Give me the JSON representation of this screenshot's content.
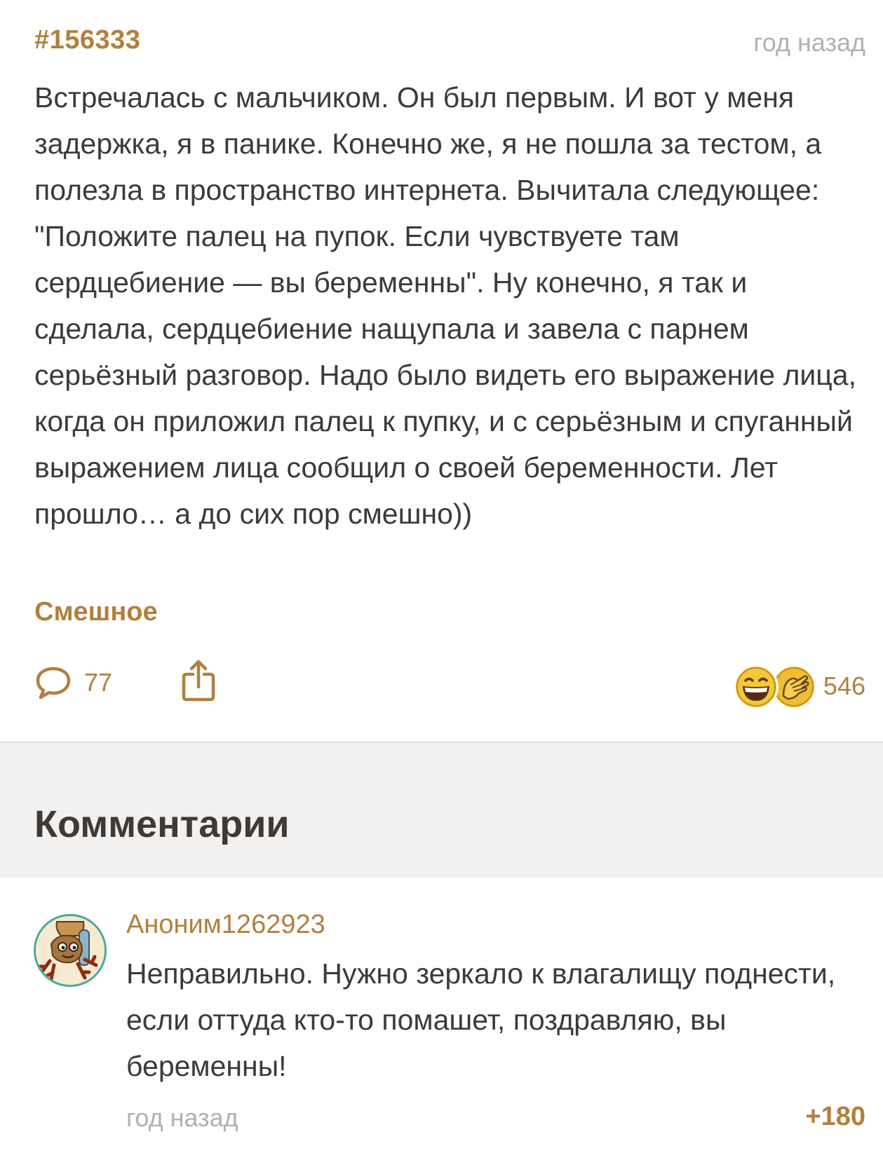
{
  "post": {
    "id": "#156333",
    "time": "год назад",
    "text": "Встречалась с мальчиком. Он был первым. И вот у меня задержка, я в панике. Конечно же, я не пошла за тестом, а полезла в пространство интернета. Вычитала следующее: \"Положите палец на пупок. Если чувствуете там сердцебиение — вы беременны\". Ну конечно, я так и сделала, сердцебиение нащупала и завела с парнем серьёзный разговор. Надо было видеть его выражение лица, когда он приложил палец к пупку, и с серьёзным и спуганный выражением лица сообщил о своей беременности. Лет прошло… а до сих пор смешно))",
    "tag": "Смешное",
    "comment_count": "77",
    "reaction_count": "546",
    "reactions": [
      "laughing-emoji",
      "facepalm-emoji"
    ],
    "share_icon": "share-icon",
    "comment_icon": "comment-bubble-icon"
  },
  "comments_section": {
    "title": "Комментарии",
    "items": [
      {
        "author": "Аноним1262923",
        "text": "Неправильно. Нужно зеркало к влагалищу поднести, если оттуда кто-то помашет, поздравляю, вы беременны!",
        "time": "год назад",
        "score": "+180",
        "avatar_icon": "cartoon-avatar"
      }
    ]
  },
  "colors": {
    "accent": "#b1803f",
    "text": "#3e3a37",
    "muted": "#b4b0ad",
    "section_bg": "#f2f1f0",
    "avatar_ring": "#49a7a2"
  }
}
